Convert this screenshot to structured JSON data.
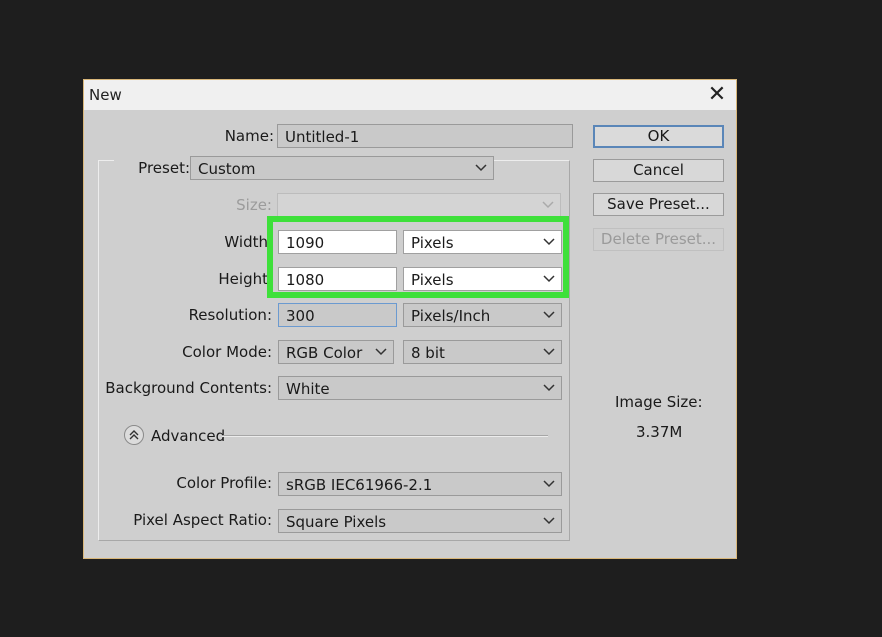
{
  "window": {
    "title": "New",
    "close_symbol": "✕"
  },
  "form": {
    "name": {
      "label": "Name:",
      "value": "Untitled-1"
    },
    "preset": {
      "label": "Preset:",
      "value": "Custom"
    },
    "size": {
      "label": "Size:",
      "value": ""
    },
    "width": {
      "label": "Width",
      "value": "1090",
      "unit": "Pixels"
    },
    "height": {
      "label": "Height",
      "value": "1080",
      "unit": "Pixels"
    },
    "resolution": {
      "label": "Resolution:",
      "value": "300",
      "unit": "Pixels/Inch"
    },
    "color_mode": {
      "label": "Color Mode:",
      "value": "RGB Color",
      "depth": "8 bit"
    },
    "background": {
      "label": "Background Contents:",
      "value": "White"
    },
    "advanced": {
      "label": "Advanced"
    },
    "color_profile": {
      "label": "Color Profile:",
      "value": "sRGB IEC61966-2.1"
    },
    "pixel_aspect": {
      "label": "Pixel Aspect Ratio:",
      "value": "Square Pixels"
    }
  },
  "buttons": {
    "ok": "OK",
    "cancel": "Cancel",
    "save_preset": "Save Preset...",
    "delete_preset": "Delete Preset..."
  },
  "image_size": {
    "label": "Image Size:",
    "value": "3.37M"
  },
  "colors": {
    "highlight": "#3ee03a",
    "dialog_bg": "#cfcfcf",
    "focus_border": "#5a86b8"
  }
}
